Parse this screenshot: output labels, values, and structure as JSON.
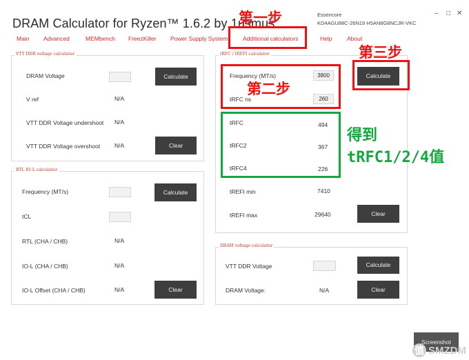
{
  "app": {
    "title": "DRAM Calculator for Ryzen™ 1.6.2 by 1usmus",
    "module_brand": "Essencore",
    "module_part": "KD4AGU88C-26N19 H5AN8G8NCJR-VKC",
    "minimize_icon": "–",
    "restore_icon": "□",
    "close_icon": "✕"
  },
  "menu": [
    "Main",
    "Advanced",
    "MEMbench",
    "FreezKiller",
    "Power Supply System",
    "Additional calculators",
    "Help",
    "About"
  ],
  "vtt_panel": {
    "title": "VTT DDR voltage calculator",
    "dram_voltage_label": "DRAM Voltage",
    "dram_voltage_value": "",
    "calculate_label": "Calculate",
    "vref_label": "V ref",
    "vref_value": "N/A",
    "undershoot_label": "VTT DDR Voltage undershoot",
    "undershoot_value": "N/A",
    "overshoot_label": "VTT DDR Voltage overshoot",
    "overshoot_value": "N/A",
    "clear_label": "Clear"
  },
  "rtl_panel": {
    "title": "RTL IO-L calculator",
    "frequency_label": "Frequency (MT/s)",
    "frequency_value": "",
    "calculate_label": "Calculate",
    "tcl_label": "tCL",
    "tcl_value": "",
    "rtl_label": "RTL (CHA / CHB)",
    "rtl_value": "N/A",
    "iol_label": "IO-L (CHA / CHB)",
    "iol_value": "N/A",
    "iol_offset_label": "IO-L Offset (CHA / CHB)",
    "iol_offset_value": "N/A",
    "clear_label": "Clear"
  },
  "trfc_panel": {
    "title": "tRFC / tREFI calculator",
    "frequency_label": "Frequency (MT/s)",
    "frequency_value": "3800",
    "trfc_ns_label": "tRFC ns",
    "trfc_ns_value": "260",
    "calculate_label": "Calculate",
    "trfc_label": "tRFC",
    "trfc_value": "494",
    "trfc2_label": "tRFC2",
    "trfc2_value": "367",
    "trfc4_label": "tRFC4",
    "trfc4_value": "226",
    "trefi_min_label": "tREFI min",
    "trefi_min_value": "7410",
    "trefi_max_label": "tREFI max",
    "trefi_max_value": "29640",
    "clear_label": "Clear"
  },
  "dram_panel": {
    "title": "DRAM voltage calculator",
    "vtt_label": "VTT DDR Voltage",
    "vtt_value": "",
    "calculate_label": "Calculate",
    "dram_voltage_label": "DRAM Voltage:",
    "dram_voltage_value": "N/A",
    "clear_label": "Clear"
  },
  "screenshot_button": "Screenshot",
  "annotations": {
    "step1": "第一步",
    "step2": "第二步",
    "step3": "第三步",
    "result_line1": "得到",
    "result_line2": "tRFC1/2/4值",
    "red_color": "#ee1111",
    "green_color": "#12a83c"
  },
  "watermark": {
    "icon": "值",
    "text": "SMZDM"
  }
}
